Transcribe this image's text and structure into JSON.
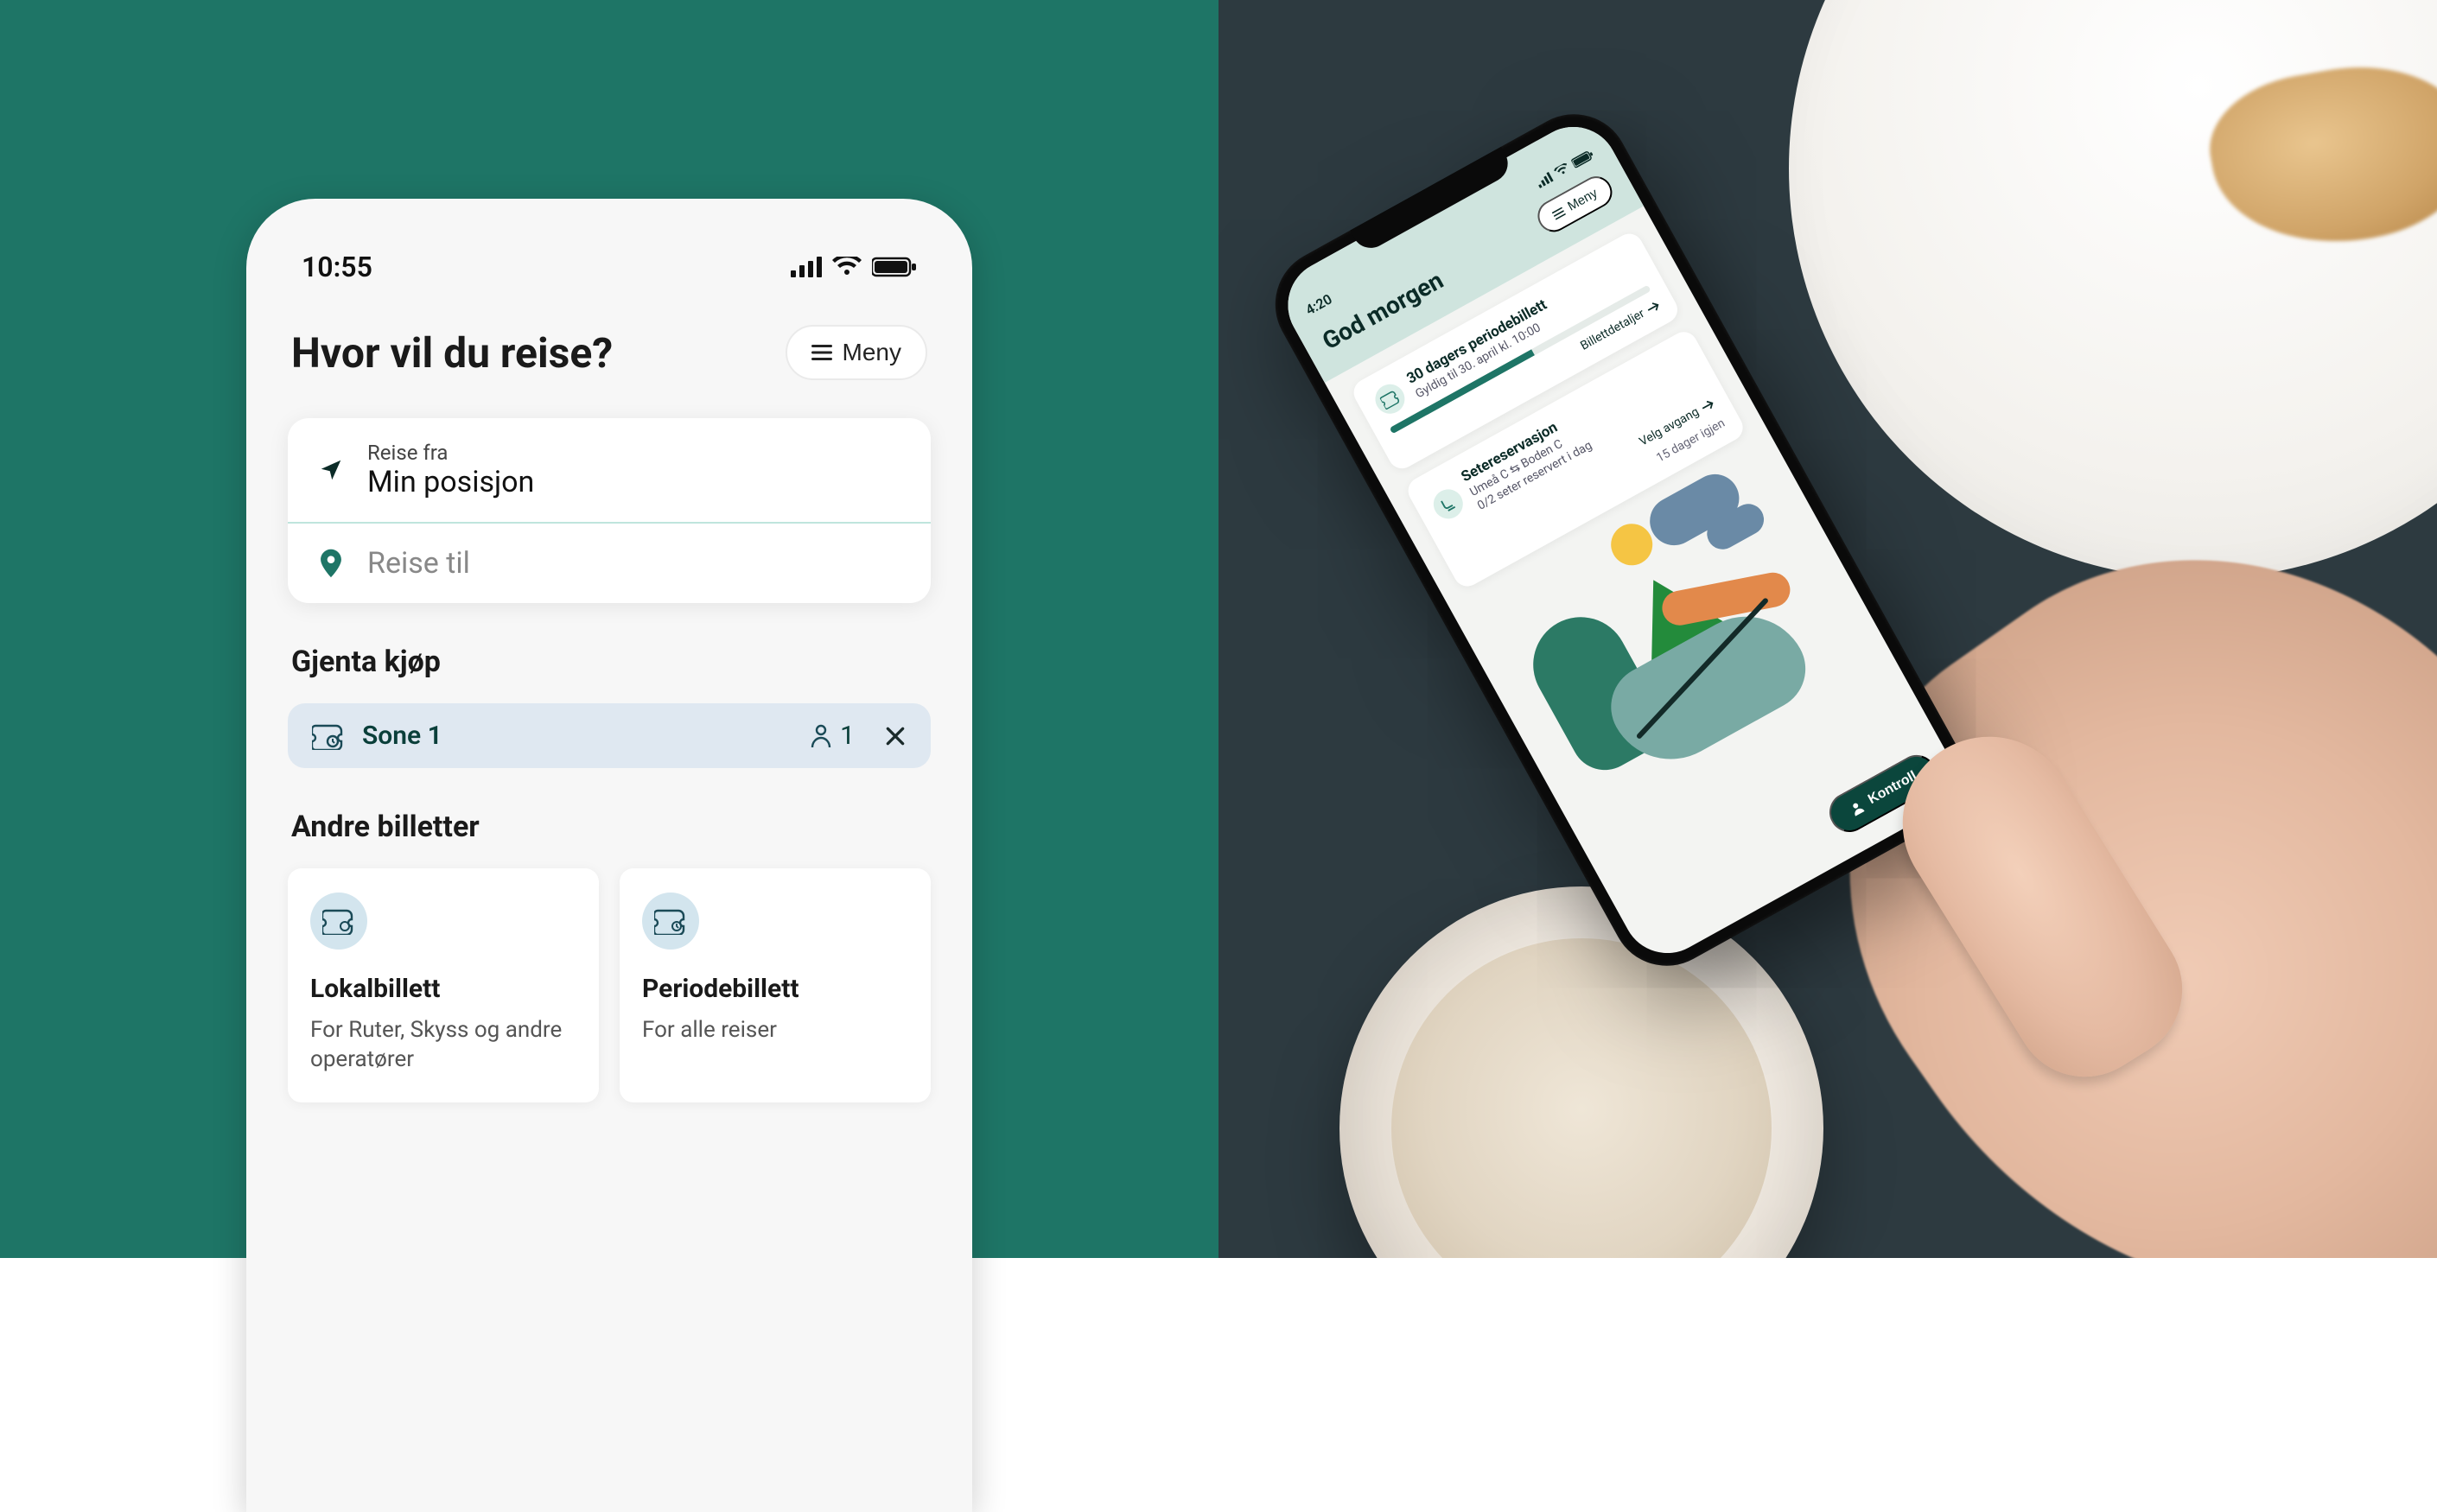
{
  "leftPhone": {
    "statusTime": "10:55",
    "heading": "Hvor vil du reise?",
    "menuLabel": "Meny",
    "journey": {
      "fromLabel": "Reise fra",
      "fromValue": "Min posisjon",
      "toPlaceholder": "Reise til"
    },
    "repeatSection": {
      "title": "Gjenta kjøp",
      "zone": "Sone 1",
      "passengerCount": "1"
    },
    "otherTickets": {
      "title": "Andre billetter",
      "cards": [
        {
          "title": "Lokalbillett",
          "desc": "For Ruter, Skyss og andre operatører"
        },
        {
          "title": "Periodebillett",
          "desc": "For alle reiser"
        }
      ]
    }
  },
  "rightPhone": {
    "statusTime": "4:20",
    "heading": "God morgen",
    "menuLabel": "Meny",
    "periodCard": {
      "title": "30 dagers periodebillett",
      "sub": "Gyldig til 30. april kl. 10:00",
      "link": "Billettdetaljer"
    },
    "seatCard": {
      "title": "Setereservasjon",
      "route": "Umeå C ⇆ Boden C",
      "sub": "0/2 seter reservert i dag",
      "link": "Velg avgang",
      "daysLeft": "15 dager igjen"
    },
    "kontroll": "Kontroll"
  }
}
